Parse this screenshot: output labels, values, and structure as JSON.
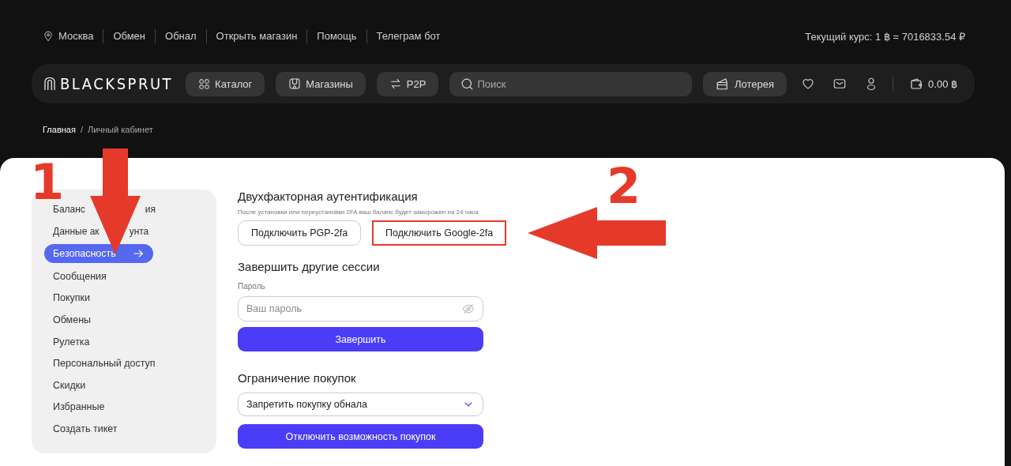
{
  "top_links": [
    {
      "text": "Москва",
      "kind": "location"
    },
    {
      "text": "Обмен",
      "kind": "link"
    },
    {
      "text": "Обнал",
      "kind": "link"
    },
    {
      "text": "Открыть магазин",
      "kind": "link"
    },
    {
      "text": "Помощь",
      "kind": "link"
    },
    {
      "text": "Телеграм бот",
      "kind": "link"
    }
  ],
  "rate": "Текущий курс: 1 ฿ = 7016833.54 ₽",
  "logo": "BLACKSPRUT",
  "nav_buttons": [
    {
      "label": "Каталог",
      "kind": "grid"
    },
    {
      "label": "Магазины",
      "kind": "shop"
    },
    {
      "label": "P2P",
      "kind": "swap"
    }
  ],
  "search": {
    "placeholder": "Поиск"
  },
  "lottery": "Лотерея",
  "balance": "0.00 ฿",
  "breadcrumbs": [
    {
      "text": "Главная",
      "selected": true
    },
    {
      "text": "Личный кабинет",
      "selected": false
    }
  ],
  "breadcrumb_separator": "/",
  "sidebar": {
    "items": [
      {
        "label": "Баланс",
        "label_after_cover": "ия",
        "selected": false,
        "highlighted": false
      },
      {
        "label": "Данные ак",
        "label_after_cover": "унта",
        "selected": false,
        "highlighted": false
      },
      {
        "label": "Безопасность",
        "selected": true,
        "highlighted": true
      },
      {
        "label": "Сообщения",
        "selected": false,
        "highlighted": false
      },
      {
        "label": "Покупки",
        "selected": false,
        "highlighted": false
      },
      {
        "label": "Обмены",
        "selected": false,
        "highlighted": false
      },
      {
        "label": "Рулетка",
        "selected": false,
        "highlighted": false
      },
      {
        "label": "Персональный доступ",
        "selected": false,
        "highlighted": false
      },
      {
        "label": "Скидки",
        "selected": false,
        "highlighted": false
      },
      {
        "label": "Избранные",
        "selected": false,
        "highlighted": false
      },
      {
        "label": "Создать тикет",
        "selected": false,
        "highlighted": false
      }
    ]
  },
  "two_factor": {
    "title": "Двухфакторная аутентификация",
    "note": "После установки или переустановки 2FA ваш баланс будет заморожен на 24 часа",
    "buttons": [
      {
        "label": "Подключить PGP-2fa",
        "highlighted": false
      },
      {
        "label": "Подключить Google-2fa",
        "highlighted": true
      }
    ]
  },
  "sessions": {
    "title": "Завершить другие сессии",
    "field_label": "Пароль",
    "placeholder": "Ваш пароль",
    "button": "Завершить"
  },
  "purchase_limit": {
    "title": "Ограничение покупок",
    "select_value": "Запретить покупку обнала",
    "button": "Отключить возможность покупок"
  },
  "annotations": [
    {
      "kind": "number",
      "text": "1"
    },
    {
      "kind": "down-arrow"
    },
    {
      "kind": "number",
      "text": "2"
    },
    {
      "kind": "left-arrow"
    }
  ]
}
